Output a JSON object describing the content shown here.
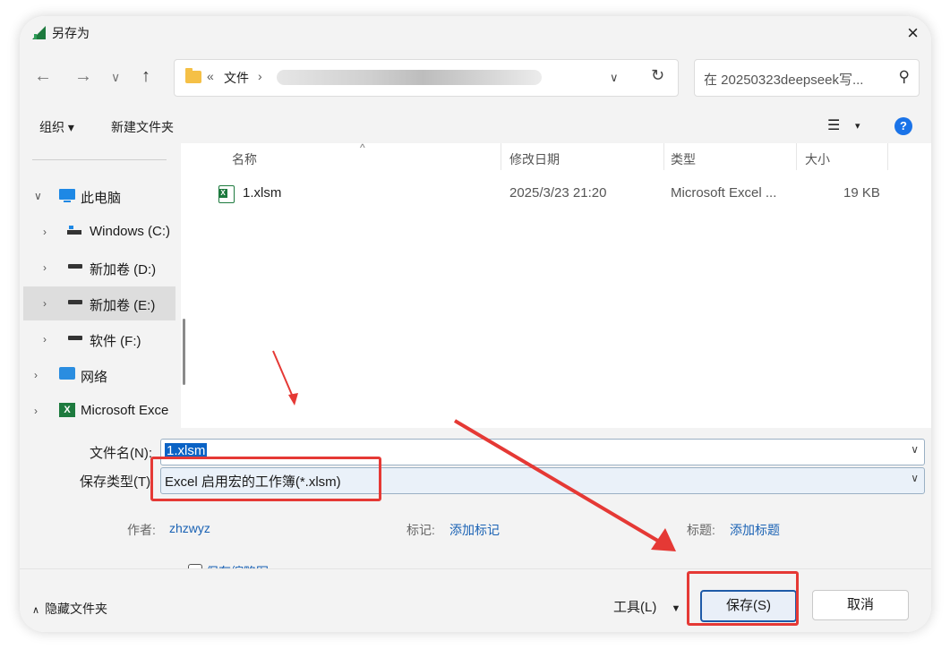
{
  "window": {
    "title": "另存为"
  },
  "nav": {
    "back": "←",
    "forward": "→",
    "recent": "∨",
    "up": "↑",
    "breadcrumb_prefix": "«",
    "breadcrumb_folder": "文件",
    "breadcrumb_sep": "›",
    "dropdown": "∨",
    "refresh": "↻",
    "search_placeholder": "在 20250323deepseek写...",
    "search_icon": "⚲"
  },
  "commands": {
    "organize": "组织 ▾",
    "new_folder": "新建文件夹",
    "view": "☰",
    "view_arrow": "▾",
    "help": "?"
  },
  "sidebar": {
    "items": [
      {
        "label": "此电脑",
        "icon": "pc-icon",
        "expanded": true
      },
      {
        "label": "Windows (C:)",
        "icon": "drive-c-icon"
      },
      {
        "label": "新加卷 (D:)",
        "icon": "drive-icon"
      },
      {
        "label": "新加卷 (E:)",
        "icon": "drive-icon",
        "selected": true
      },
      {
        "label": "软件 (F:)",
        "icon": "drive-icon"
      },
      {
        "label": "网络",
        "icon": "network-icon"
      },
      {
        "label": "Microsoft Exce",
        "icon": "excel-icon"
      }
    ],
    "chev_expanded": "∨",
    "chev_collapsed": "›"
  },
  "columns": {
    "name": "名称",
    "modified": "修改日期",
    "type": "类型",
    "size": "大小"
  },
  "files": [
    {
      "name": "1.xlsm",
      "modified": "2025/3/23 21:20",
      "type": "Microsoft Excel ...",
      "size": "19 KB"
    }
  ],
  "form": {
    "filename_label": "文件名(N):",
    "filename_value": "1.xlsm",
    "filetype_label": "保存类型(T):",
    "filetype_value": "Excel 启用宏的工作簿(*.xlsm)",
    "author_label": "作者:",
    "author_value": "zhzwyz",
    "tags_label": "标记:",
    "tags_value": "添加标记",
    "title_label": "标题:",
    "title_value": "添加标题",
    "thumbnail_label": "保存缩略图",
    "dropdown": "∨"
  },
  "footer": {
    "hide_folders": "隐藏文件夹",
    "hide_chev": "∧",
    "tools": "工具(L)",
    "tools_arrow": "▼",
    "save": "保存(S)",
    "cancel": "取消"
  },
  "colors": {
    "accent": "#1e5aa8",
    "annotation": "#e53935",
    "excel_green": "#1d7a3e"
  }
}
